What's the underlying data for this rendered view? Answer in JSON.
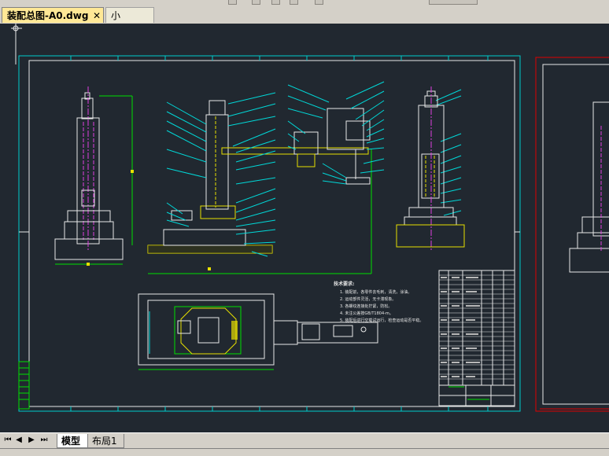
{
  "tabs": {
    "active_label": "装配总图-A0.dwg",
    "inactive_label": "小臂.dwg",
    "close_glyph": "✕"
  },
  "layout_tabs": {
    "model_label": "模型",
    "layout1_label": "布局1"
  },
  "nav_buttons": [
    "⏮",
    "◀",
    "▶",
    "⏭"
  ],
  "drawing": {
    "notes_title": "技术要求:",
    "notes": [
      "1. 装配前，各零件去毛刺，清洗，涂油。",
      "2. 运动部件灵活，无卡滞现象。",
      "3. 各螺纹连接处拧紧，防松。",
      "4. 未注公差按GB/T1804-m。",
      "5. 装配后进行空载试运行，检查运动是否平稳。"
    ]
  },
  "colors": {
    "canvas_bg": "#212830",
    "frame_cyan": "#00cccc",
    "frame_white": "#e8e8e8",
    "part_yellow": "#e8e000",
    "leader_cyan": "#00d8d8",
    "center_magenta": "#e040e0",
    "dim_green": "#00e000",
    "sheet_red": "#e00000",
    "active_tab": "#ffe896"
  }
}
